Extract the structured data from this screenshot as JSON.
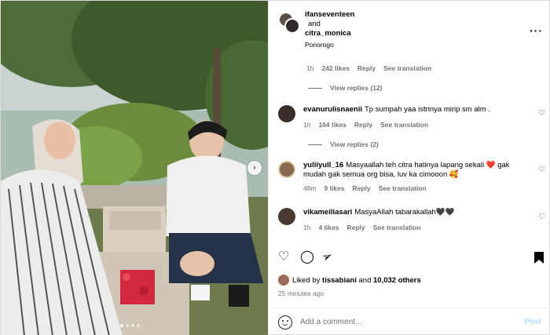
{
  "post": {
    "header": {
      "user1": "ifanseventeen",
      "and": "and",
      "user2": "citra_monica",
      "location": "Ponorogo",
      "more_icon": "more-horizontal-icon"
    },
    "prev_comment_meta": {
      "time": "1h",
      "likes": "242 likes",
      "reply": "Reply",
      "translate": "See translation"
    },
    "view_replies_1": "View replies (12)",
    "comments": [
      {
        "user": "evanurulisnaenii",
        "text": "Tp sumpah yaa istrinya mirip sm alm .",
        "time": "1h",
        "likes": "164 likes",
        "reply": "Reply",
        "translate": "See translation",
        "view_replies": "View replies (2)"
      },
      {
        "user": "yuliiyull_16",
        "text": "Masyaallah teh citra hatinya lapang sekali ❤️ gak mudah gak semua org bisa, luv ka cimooon 🥰",
        "time": "48m",
        "likes": "9 likes",
        "reply": "Reply",
        "translate": "See translation"
      },
      {
        "user": "vikameiliasari",
        "text": "MasyaAllah tabarakallah🖤🖤",
        "time": "1h",
        "likes": "4 likes",
        "reply": "Reply",
        "translate": "See translation"
      }
    ],
    "actions": {
      "like_icon": "heart-icon",
      "comment_icon": "comment-icon",
      "share_icon": "share-icon",
      "save_icon": "bookmark-icon"
    },
    "liked_by": {
      "prefix": "Liked by",
      "user": "tissabiani",
      "middle": "and",
      "others": "10,032 others"
    },
    "timestamp": "25 minutes ago",
    "composer": {
      "placeholder": "Add a comment...",
      "post": "Post"
    }
  }
}
